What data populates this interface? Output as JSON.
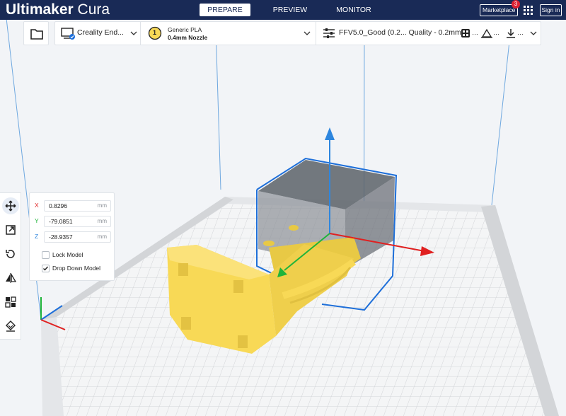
{
  "app": {
    "name_bold": "Ultimaker",
    "name_rest": " Cura"
  },
  "stages": [
    {
      "label": "PREPARE",
      "active": true
    },
    {
      "label": "PREVIEW",
      "active": false
    },
    {
      "label": "MONITOR",
      "active": false
    }
  ],
  "header_right": {
    "marketplace": "Marketplace",
    "marketplace_badge": "3",
    "sign_in": "Sign in"
  },
  "printer": {
    "name": "Creality End..."
  },
  "material": {
    "name": "Generic PLA",
    "nozzle": "0.4mm Nozzle",
    "extruder_number": "1"
  },
  "print_settings": {
    "profile": "FFV5.0_Good (0.2... Quality - 0.2mm"
  },
  "tools": [
    "move-tool-icon",
    "scale-tool-icon",
    "rotate-tool-icon",
    "mirror-tool-icon",
    "per-model-settings-icon",
    "support-blocker-icon"
  ],
  "move_panel": {
    "x": {
      "axis": "X",
      "value": "0.8296",
      "unit": "mm"
    },
    "y": {
      "axis": "Y",
      "value": "-79.0851",
      "unit": "mm"
    },
    "z": {
      "axis": "Z",
      "value": "-28.9357",
      "unit": "mm"
    },
    "lock_model": {
      "label": "Lock Model",
      "checked": false
    },
    "drop_down_model": {
      "label": "Drop Down Model",
      "checked": true
    }
  },
  "colors": {
    "header": "#192a56",
    "model": "#f8d956",
    "selection": "#1e6fd9",
    "axis_x": "#e02020",
    "axis_y": "#1fb43a",
    "axis_z": "#2e86de"
  }
}
